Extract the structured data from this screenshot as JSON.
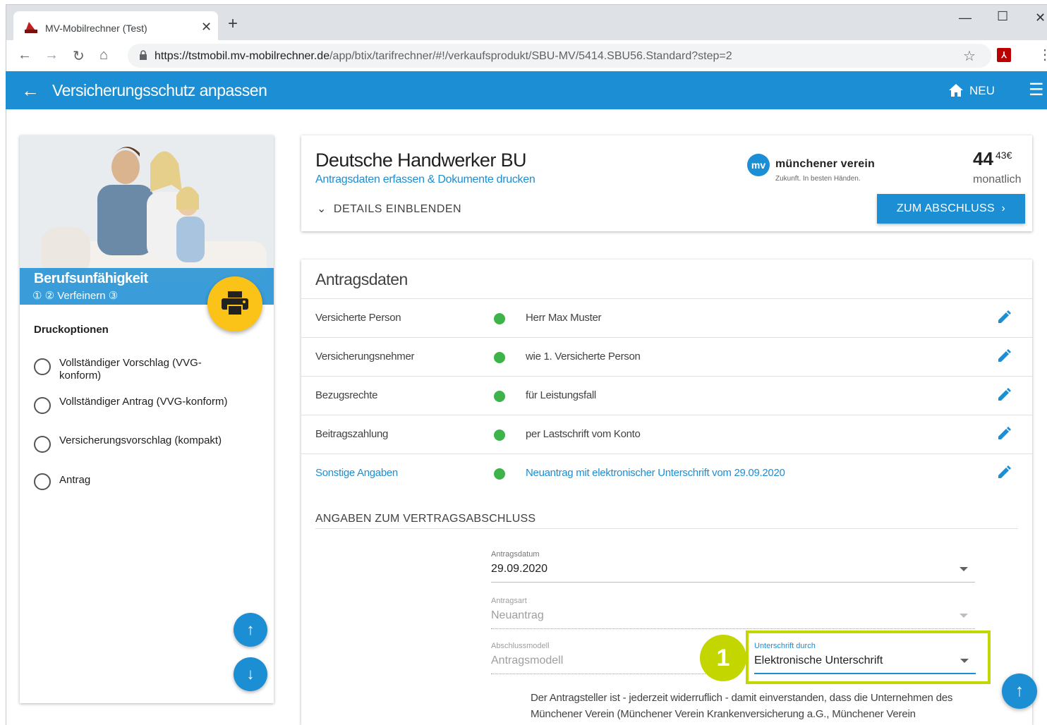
{
  "browser": {
    "tab_title": "MV-Mobilrechner (Test)",
    "url_host": "https://tstmobil.mv-mobilrechner.de",
    "url_path": "/app/btix/tarifrechner/#!/verkaufsprodukt/SBU-MV/5414.SBU56.Standard?step=2"
  },
  "appbar": {
    "title": "Versicherungsschutz anpassen",
    "home_label": "NEU"
  },
  "sidebar": {
    "product": "Berufsunfähigkeit",
    "steps": "① ② Verfeinern ③",
    "section_title": "Druckoptionen",
    "options": [
      "Vollständiger Vorschlag (VVG-konform)",
      "Vollständiger Antrag (VVG-konform)",
      "Versicherungsvorschlag (kompakt)",
      "Antrag"
    ]
  },
  "product": {
    "name": "Deutsche Handwerker BU",
    "subtitle": "Antragsdaten erfassen & Dokumente drucken",
    "details_label": "DETAILS EINBLENDEN",
    "insurer_logo": "mv",
    "insurer_name": "münchener verein",
    "insurer_slogan": "Zukunft. In besten Händen.",
    "price_main": "44",
    "price_cents": "43€",
    "price_period": "monatlich",
    "cta_label": "ZUM ABSCHLUSS",
    "cta_chevron": "›"
  },
  "antragsdaten": {
    "title": "Antragsdaten",
    "rows": [
      {
        "label": "Versicherte Person",
        "value": "Herr Max Muster"
      },
      {
        "label": "Versicherungsnehmer",
        "value": "wie 1. Versicherte Person"
      },
      {
        "label": "Bezugsrechte",
        "value": "für Leistungsfall"
      },
      {
        "label": "Beitragszahlung",
        "value": "per Lastschrift vom Konto"
      },
      {
        "label": "Sonstige Angaben",
        "value": "Neuantrag mit elektronischer Unterschrift vom 29.09.2020"
      }
    ],
    "status_color": "#3db34a",
    "section_heading": "ANGABEN ZUM VERTRAGSABSCHLUSS",
    "fields": {
      "antragsdatum": {
        "label": "Antragsdatum",
        "value": "29.09.2020"
      },
      "antragsart": {
        "label": "Antragsart",
        "value": "Neuantrag"
      },
      "abschlussmodell": {
        "label": "Abschlussmodell",
        "value": "Antragsmodell"
      },
      "unterschrift": {
        "label": "Unterschrift durch",
        "value": "Elektronische Unterschrift"
      }
    },
    "callout_number": "1",
    "consent_text": "Der Antragsteller ist - jederzeit widerruflich - damit einverstanden, dass die Unternehmen des Münchener Verein (Münchener Verein Krankenversicherung a.G., Münchener Verein"
  },
  "colors": {
    "primary": "#1b8ed4",
    "accent": "#fbc217",
    "highlight": "#c4d600"
  }
}
